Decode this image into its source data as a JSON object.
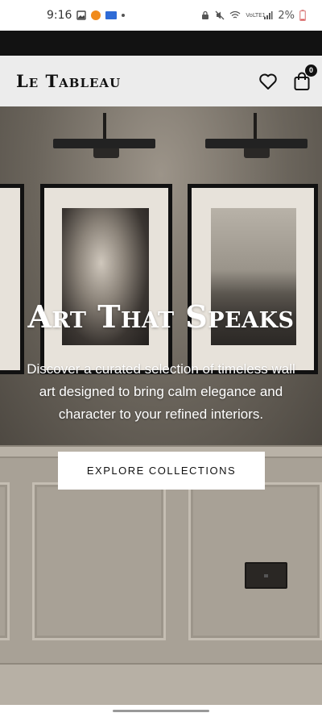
{
  "status_bar": {
    "time": "9:16",
    "battery": "2%",
    "icons": [
      "gallery-icon",
      "bitcoin-icon",
      "app-badge-icon",
      "notification-dot-icon",
      "lock-icon",
      "mute-icon",
      "wifi-icon",
      "volte-icon",
      "signal-icon",
      "battery-icon"
    ],
    "volte_label": "VoLTE1"
  },
  "header": {
    "logo": "Le Tableau",
    "wishlist_icon": "heart-icon",
    "cart_icon": "bag-icon",
    "cart_count": "0"
  },
  "hero": {
    "title": "Art That Speaks",
    "description": "Discover a curated selection of timeless wall art designed to bring calm elegance and character to your refined interiors.",
    "cta_label": "EXPLORE COLLECTIONS"
  },
  "colors": {
    "header_bg": "#ececec",
    "hero_text": "#ffffff",
    "cta_bg": "#ffffff",
    "cta_text": "#111111",
    "badge_orange": "#f08a1b",
    "badge_blue": "#2f6bd6"
  }
}
